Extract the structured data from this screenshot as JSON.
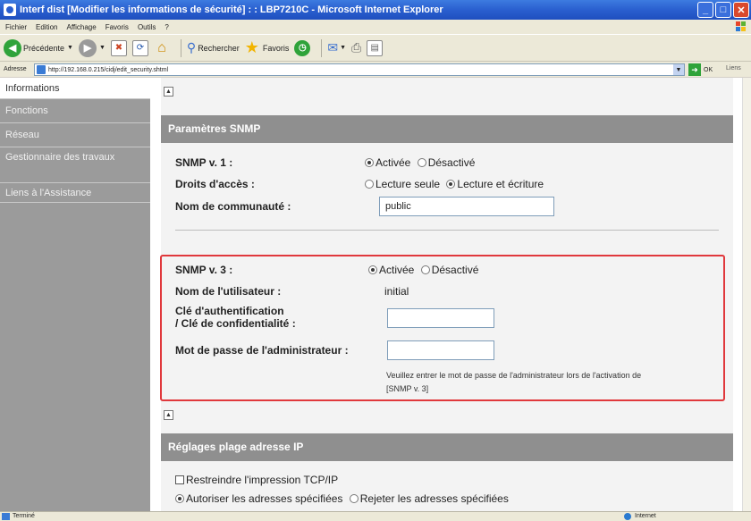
{
  "window": {
    "title": "Interf dist [Modifier les informations de sécurité] : : LBP7210C - Microsoft Internet Explorer"
  },
  "menu": [
    "Fichier",
    "Edition",
    "Affichage",
    "Favoris",
    "Outils",
    "?"
  ],
  "toolbar": {
    "back_label": "Précédente",
    "search_label": "Rechercher",
    "favorites_label": "Favoris"
  },
  "address": {
    "label": "Adresse",
    "url": "http://192.168.0.215/cidj/edit_security.shtml",
    "go_label": "OK",
    "links_label": "Liens"
  },
  "sidebar": {
    "items": [
      {
        "label": "Informations"
      },
      {
        "label": "Fonctions"
      },
      {
        "label": "Réseau"
      },
      {
        "label": "Gestionnaire des travaux"
      },
      {
        "label": "Liens à l'Assistance"
      }
    ]
  },
  "snmp": {
    "header": "Paramètres SNMP",
    "v1_label": "SNMP v. 1 :",
    "v1_on": "Activée",
    "v1_off": "Désactivé",
    "rights_label": "Droits d'accès :",
    "rights_readonly": "Lecture seule",
    "rights_readwrite": "Lecture et écriture",
    "community_label": "Nom de communauté :",
    "community_value": "public",
    "v3_label": "SNMP v. 3 :",
    "v3_on": "Activée",
    "v3_off": "Désactivé",
    "user_label": "Nom de l'utilisateur :",
    "user_value": "initial",
    "auth_label_1": "Clé d'authentification",
    "auth_label_2": "/ Clé de confidentialité :",
    "admin_pw_label": "Mot de passe de l'administrateur :",
    "note_1": "Veuillez entrer le mot de passe de l'administrateur lors de l'activation de",
    "note_2": "[SNMP v. 3]"
  },
  "ip": {
    "header": "Réglages plage adresse IP",
    "restrict_label": "Restreindre l'impression TCP/IP",
    "allow_label": "Autoriser les adresses spécifiées",
    "reject_label": "Rejeter les adresses spécifiées"
  },
  "status": {
    "text": "Terminé",
    "zone": "Internet"
  }
}
